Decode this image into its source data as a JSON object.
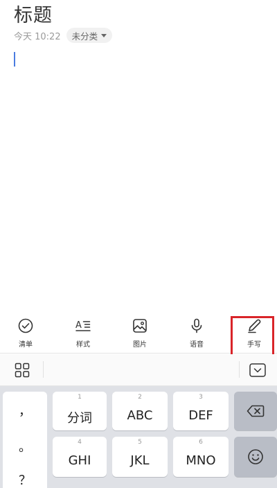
{
  "note": {
    "title": "标题",
    "time": "今天 10:22",
    "category": "未分类"
  },
  "toolbar": {
    "items": [
      {
        "label": "清单",
        "icon": "checklist-icon"
      },
      {
        "label": "样式",
        "icon": "text-style-icon"
      },
      {
        "label": "图片",
        "icon": "image-icon"
      },
      {
        "label": "语音",
        "icon": "microphone-icon"
      },
      {
        "label": "手写",
        "icon": "pen-icon"
      }
    ],
    "highlighted": "手写",
    "highlight_color": "#d92429"
  },
  "keyboard": {
    "bar_icons": [
      "grid-icon",
      "collapse-keyboard-icon"
    ],
    "punctuation": [
      "，",
      "。",
      "？"
    ],
    "rows": [
      [
        {
          "num": "1",
          "label": "分词"
        },
        {
          "num": "2",
          "label": "ABC"
        },
        {
          "num": "3",
          "label": "DEF"
        }
      ],
      [
        {
          "num": "4",
          "label": "GHI"
        },
        {
          "num": "5",
          "label": "JKL"
        },
        {
          "num": "6",
          "label": "MNO"
        }
      ]
    ],
    "function_keys": [
      "backspace-icon",
      "emoji-icon"
    ]
  }
}
